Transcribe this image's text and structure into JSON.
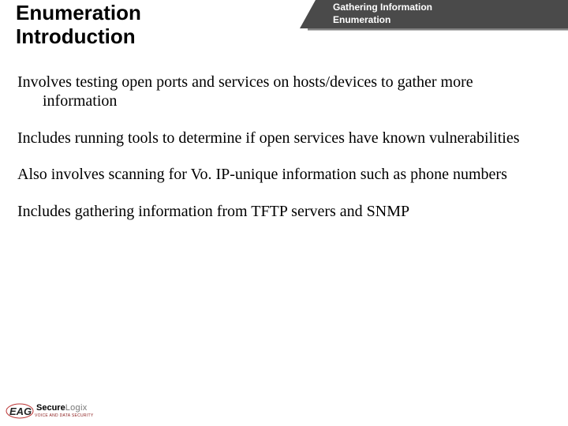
{
  "header": {
    "tab_line1": "Gathering Information",
    "tab_line2": "Enumeration",
    "title_line1": "Enumeration",
    "title_line2": "Introduction"
  },
  "bullets": [
    "Involves testing open ports and services on hosts/devices to gather more information",
    "Includes running tools to determine if open services have known vulnerabilities",
    "Also involves scanning for Vo. IP-unique information such as phone numbers",
    "Includes gathering information from TFTP servers and SNMP"
  ],
  "logo": {
    "brand_bold": "Secure",
    "brand_light": "Logix",
    "tagline": "VOICE AND DATA SECURITY"
  }
}
